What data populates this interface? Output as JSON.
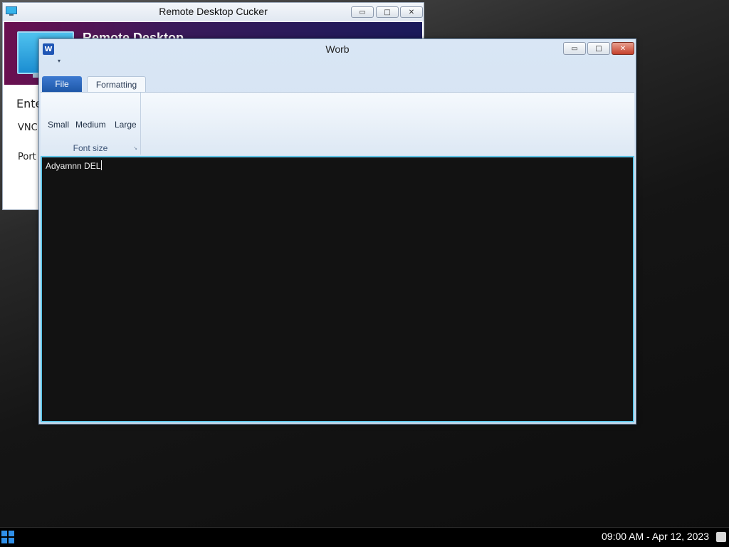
{
  "remote_desktop": {
    "title": "Remote Desktop Cucker",
    "banner_title": "Remote Desktop",
    "enter_label": "Ente",
    "vnc_label": "VNC",
    "port_label": "Port",
    "min_glyph": "▭",
    "max_glyph": "□",
    "close_glyph": "✕"
  },
  "worb": {
    "title": "Worb",
    "app_icon_letter": "W",
    "qat_glyph": "▾",
    "min_glyph": "▭",
    "max_glyph": "□",
    "close_glyph": "✕",
    "tabs": [
      {
        "label": "File"
      },
      {
        "label": "Formatting"
      }
    ],
    "ribbon": {
      "font_size_group": {
        "label": "Font size",
        "buttons": [
          {
            "label": "Small"
          },
          {
            "label": "Medium"
          },
          {
            "label": "Large"
          }
        ],
        "launcher_glyph": "↘"
      }
    },
    "editor": {
      "text": "Adyamnn DEL"
    }
  },
  "taskbar": {
    "clock": "09:00 AM - Apr 12, 2023"
  }
}
